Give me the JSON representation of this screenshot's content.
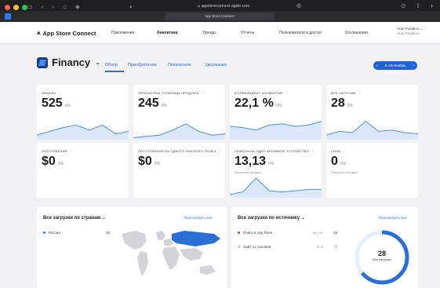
{
  "browser": {
    "url": "appstoreconnect.apple.com",
    "tab_title": "App Store Connect"
  },
  "appnav": {
    "brand": "App Store Connect",
    "items": [
      {
        "label": "Приложения"
      },
      {
        "label": "Аналитика"
      },
      {
        "label": "Тренды"
      },
      {
        "label": "Отчеты"
      },
      {
        "label": "Пользователи и доступ"
      },
      {
        "label": "Соглашения"
      }
    ],
    "user_name": "Ivan Pusakov",
    "user_sub": "Ivan Pusakov"
  },
  "header": {
    "app_name": "Financy",
    "tabs": [
      {
        "label": "Обзор"
      },
      {
        "label": "Приобретение"
      },
      {
        "label": "Показатели"
      },
      {
        "label": "Удержание"
      }
    ],
    "date_range": "8–18 Ноябрь"
  },
  "metrics": [
    {
      "title": "ПОКАЗЫ",
      "value": "525",
      "pct": "0%",
      "note": "",
      "trend": [
        0.15,
        0.3,
        0.45,
        0.55,
        0.35,
        0.55,
        0.2,
        0.3
      ]
    },
    {
      "title": "ПРОСМОТРЫ СТРАНИЦЫ ПРОДУКТА",
      "value": "245",
      "pct": "0%",
      "note": "",
      "trend": [
        0.05,
        0.1,
        0.15,
        0.35,
        0.6,
        0.3,
        0.15,
        0.2
      ]
    },
    {
      "title": "КОЭФФИЦИЕНТ КОНВЕРСИИ",
      "value": "22,1 %",
      "pct": "0%",
      "note": "",
      "trend": [
        0.5,
        0.45,
        0.35,
        0.55,
        0.6,
        0.5,
        0.55,
        0.7
      ]
    },
    {
      "title": "ВСЕ ЗАГРУЗКИ",
      "value": "28",
      "pct": "0%",
      "note": "",
      "trend": [
        0.15,
        0.3,
        0.25,
        0.7,
        0.3,
        0.35,
        0.25,
        0.2
      ]
    },
    {
      "title": "ПОСТУПЛЕНИЯ",
      "value": "$0",
      "pct": "0%",
      "note": "",
      "trend": []
    },
    {
      "title": "ПОСТУПЛЕНИЯ НА ОДНОГО ПЛАТНОГО ПОЛЬЗ",
      "value": "$0",
      "pct": "0%",
      "note": "",
      "trend": []
    },
    {
      "title": "СЕАНСЫ НА ОДНО АКТИВНОЕ УСТРОЙСТВО",
      "value": "13,13",
      "pct": "0%",
      "note": "Получено сегодня",
      "trend": [
        0.1,
        0.2,
        0.75,
        0.25,
        0.2,
        0.25,
        0.3,
        0.3
      ]
    },
    {
      "title": "СБОИ",
      "value": "0",
      "pct": "0%",
      "note": "Получено сегодня",
      "trend": []
    }
  ],
  "countries_panel": {
    "title": "Все загрузки по странам",
    "link": "Просмотреть все",
    "rows": [
      {
        "label": "Россия",
        "value": "18"
      }
    ]
  },
  "source_panel": {
    "title": "Все загрузки по источнику",
    "link": "Просмотреть все",
    "rows": [
      {
        "label": "Поиск в App Store",
        "pct": "64,3 %",
        "value": "18"
      },
      {
        "label": "Сайт со ссылкой",
        "pct": "25 %",
        "value": "7"
      }
    ],
    "total": "28",
    "total_label": "Все загрузки"
  },
  "colors": {
    "accent": "#2a6fd6",
    "spark_fill": "#dbe8fb",
    "spark_line": "#4a8ee6"
  }
}
